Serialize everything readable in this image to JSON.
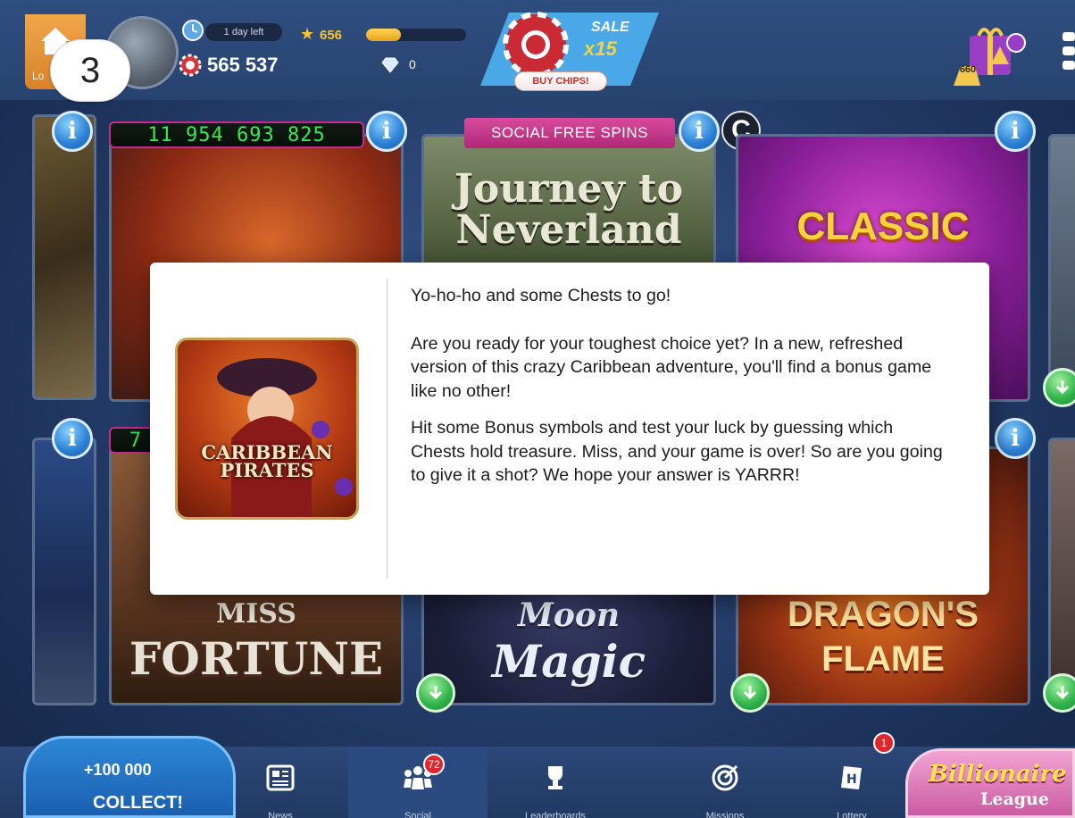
{
  "header": {
    "lobby_label": "Lo",
    "tutorial_step": "3",
    "event_timer": "1 day left",
    "xp_level": "656",
    "xp_progress": 0.35,
    "chips_balance": "565 537",
    "gems_balance": "0",
    "sale": {
      "label": "SALE",
      "multiplier": "x15",
      "button_label": "BUY CHIPS!"
    },
    "gift_count": "660"
  },
  "tiles": {
    "pirates_jackpot": "11 954 693 825",
    "neverland_tag": "SOCIAL FREE SPINS",
    "neverland_title_line1": "Journey to",
    "neverland_title_line2": "Neverland",
    "classic_title": "CLASSIC",
    "classic_badge": "C",
    "row2_jackpot_prefix": "7",
    "miss_fortune_line1": "MISS",
    "miss_fortune_line2": "FORTUNE",
    "moon_magic_line1": "Moon",
    "moon_magic_line2": "Magic",
    "dragons_flame_line1": "DRAGON'S",
    "dragons_flame_line2": "FLAME"
  },
  "popup": {
    "thumb_title_line1": "CARIBBEAN",
    "thumb_title_line2": "PIRATES",
    "headline": "Yo-ho-ho and some Chests to go!",
    "paragraph1": "Are you ready for your toughest choice yet? In a new, refreshed version of this crazy Caribbean adventure, you'll find a bonus game like no other!",
    "paragraph2": "Hit some Bonus symbols and test your luck by guessing which Chests hold treasure. Miss, and your game is over! So are you going to give it a shot? We hope your answer is YARRR!"
  },
  "bottom": {
    "collect_amount": "+100 000",
    "collect_label": "COLLECT!",
    "nav": [
      {
        "label": "News",
        "badge": ""
      },
      {
        "label": "Social",
        "badge": "72"
      },
      {
        "label": "Leaderboards",
        "badge": ""
      },
      {
        "label": "Missions",
        "badge": ""
      },
      {
        "label": "Lottery",
        "badge": "1"
      }
    ],
    "billionaire_title": "Billionaire",
    "billionaire_sub": "League"
  },
  "colors": {
    "background": "#223a66",
    "jackpot_text": "#37ea55",
    "accent_pink": "#c52a8e",
    "info_blue": "#2b7fd4",
    "download_green": "#2fb24a"
  },
  "icons": [
    "home-icon",
    "clock-icon",
    "star-icon",
    "chip-icon",
    "diamond-icon",
    "gift-icon",
    "menu-icon",
    "info-icon",
    "download-icon",
    "news-icon",
    "social-icon",
    "leaderboards-icon",
    "missions-icon",
    "lottery-icon"
  ]
}
